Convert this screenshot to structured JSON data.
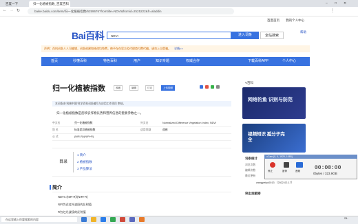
{
  "browser": {
    "tabs": [
      {
        "label": "百度一下"
      },
      {
        "label": "归一化植被指数_百度百科"
      }
    ],
    "url": "baike.baidu.com/item/归一化植被指数/6259676?fromtitle=NDVI&fromid=2525222&fr=aladdin",
    "toplinks": [
      "百度首页",
      "我的个人中心"
    ]
  },
  "header": {
    "logo": "Bai百科",
    "search_value": "NDVI",
    "btn_search": "进入词条",
    "btn_full": "全站搜索",
    "help": "帮助"
  },
  "notice": "声明：百科词条人人可编辑，词条创建和修改均免费，绝不存在官方及代理商付费代编，请勿上当受骗。",
  "notice_link": "详情>>",
  "nav": {
    "items": [
      "首页",
      "秒懂百科",
      "特色百科",
      "用户",
      "知识专题",
      "权威合作"
    ],
    "download": "下载百科APP",
    "center": "个人中心"
  },
  "article": {
    "title": "归一化植被指数",
    "actions": [
      "收藏",
      "编辑",
      "讨论",
      "上传视频"
    ],
    "infobar": "本词条由“科普中国”科学百科词条编写与应用工作项目 审核。",
    "summary": "归一化植被指数是反映农作物长势和营养信息的重要参数之一。",
    "info_rows": [
      {
        "k1": "中文名",
        "v1": "归一化植被指数",
        "k2": "外文名",
        "v2": "Normalized Difference Vegetation Index, NDVI"
      },
      {
        "k1": "别 名",
        "v1": "标准差异植被指数",
        "k2": "适用领域",
        "v2": "遥感"
      },
      {
        "k1": "公 式",
        "v1": "(NIR-R)/(NIR+R)",
        "k2": "",
        "v2": ""
      }
    ],
    "toc_label": "目录",
    "toc": [
      "1  简介",
      "2  植被指数",
      "3  产品算法"
    ],
    "section_title": "简介",
    "paras": [
      "NDVI=(NIR-R)/(NIR+R)",
      "NIR为近红外波段的反射值",
      "R为红光波段的反射值"
    ]
  },
  "rightrail": {
    "label": "V百科",
    "card1": "网络钓鱼 识别与防范",
    "card2": "视频知识 孤分子完全",
    "stats": [
      "词条统计",
      "浏览次数",
      "编辑次数",
      "最近更新"
    ],
    "contrib": "突出贡献榜",
    "updater": "wangpeiyu0013 （2022-02-17）"
  },
  "recorder": {
    "title": "oCam [0, 0, 1920, 1080]",
    "time": "00:00:00",
    "size": "0bytes / 323.9GB",
    "buttons": [
      "停止",
      "暂停",
      "音频",
      "录制编辑"
    ]
  },
  "taskbar": {
    "search_placeholder": "在这里输入你要搜索的内容",
    "clock": "21:"
  },
  "colors": {
    "accent": "#3872e0",
    "recorder_stop": "#d9342b"
  }
}
